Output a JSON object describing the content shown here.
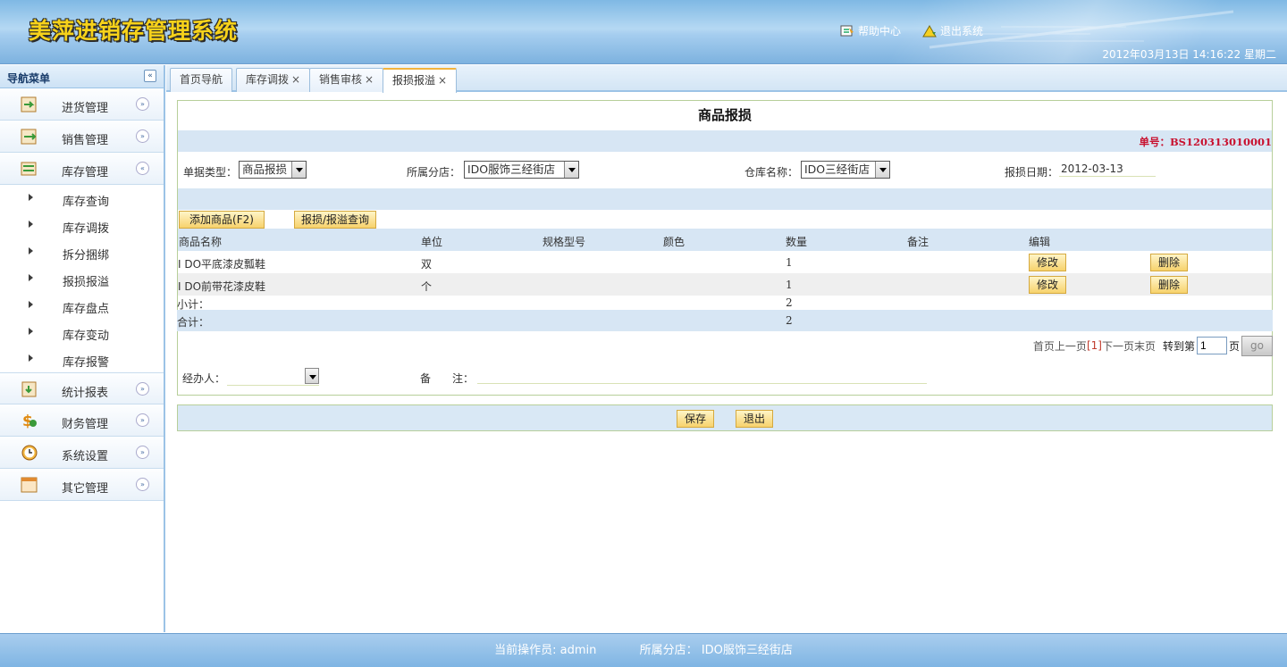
{
  "app": {
    "title": "美萍进销存管理系统"
  },
  "header": {
    "help_label": "帮助中心",
    "logout_label": "退出系统",
    "datetime": "2012年03月13日 14:16:22 星期二"
  },
  "sidebar": {
    "title": "导航菜单",
    "collapse_glyph": "«",
    "groups": [
      {
        "label": "进货管理",
        "chev": "»"
      },
      {
        "label": "销售管理",
        "chev": "»"
      },
      {
        "label": "库存管理",
        "chev": "«"
      },
      {
        "label": "统计报表",
        "chev": "»"
      },
      {
        "label": "财务管理",
        "chev": "»"
      },
      {
        "label": "系统设置",
        "chev": "»"
      },
      {
        "label": "其它管理",
        "chev": "»"
      }
    ],
    "sub_items": [
      "库存查询",
      "库存调拨",
      "拆分捆绑",
      "报损报溢",
      "库存盘点",
      "库存变动",
      "库存报警"
    ]
  },
  "tabs": [
    {
      "label": "首页导航",
      "close": ""
    },
    {
      "label": "库存调拨",
      "close": "×"
    },
    {
      "label": "销售审核",
      "close": "×"
    },
    {
      "label": "报损报溢",
      "close": "×"
    }
  ],
  "form": {
    "title": "商品报损",
    "bill_no": "单号：BS120313010001",
    "type_label": "单据类型：",
    "type_value": "商品报损",
    "branch_label": "所属分店：",
    "branch_value": "IDO服饰三经街店",
    "warehouse_label": "仓库名称：",
    "warehouse_value": "IDO三经街店",
    "date_label": "报损日期：",
    "date_value": "2012-03-13",
    "add_button": "添加商品(F2)",
    "query_button": "报损/报溢查询"
  },
  "table": {
    "headers": [
      "商品名称",
      "单位",
      "规格型号",
      "颜色",
      "数量",
      "备注",
      "编辑"
    ],
    "rows": [
      {
        "name": "I DO平底漆皮瓢鞋",
        "unit": "双",
        "spec": "",
        "color": "",
        "qty": "1",
        "note": "",
        "edit": "修改",
        "delete": "删除"
      },
      {
        "name": "I DO前带花漆皮鞋",
        "unit": "个",
        "spec": "",
        "color": "",
        "qty": "1",
        "note": "",
        "edit": "修改",
        "delete": "删除"
      }
    ],
    "subtotal_label": "小计：",
    "subtotal_qty": "2",
    "total_label": "合计：",
    "total_qty": "2"
  },
  "pager": {
    "first": "首页",
    "prev": "上一页",
    "current": "[1]",
    "next": "下一页",
    "last": "末页",
    "goto_label": "转到第",
    "page_value": "1",
    "page_unit": "页",
    "go": "go"
  },
  "bottom": {
    "handler_label": "经办人：",
    "handler_value": "",
    "note_label": "备　　注：",
    "note_value": ""
  },
  "actions": {
    "save": "保存",
    "exit": "退出"
  },
  "footer": {
    "operator_label": "当前操作员:",
    "operator": "admin",
    "branch_label": "所属分店：",
    "branch": "IDO服饰三经街店"
  }
}
